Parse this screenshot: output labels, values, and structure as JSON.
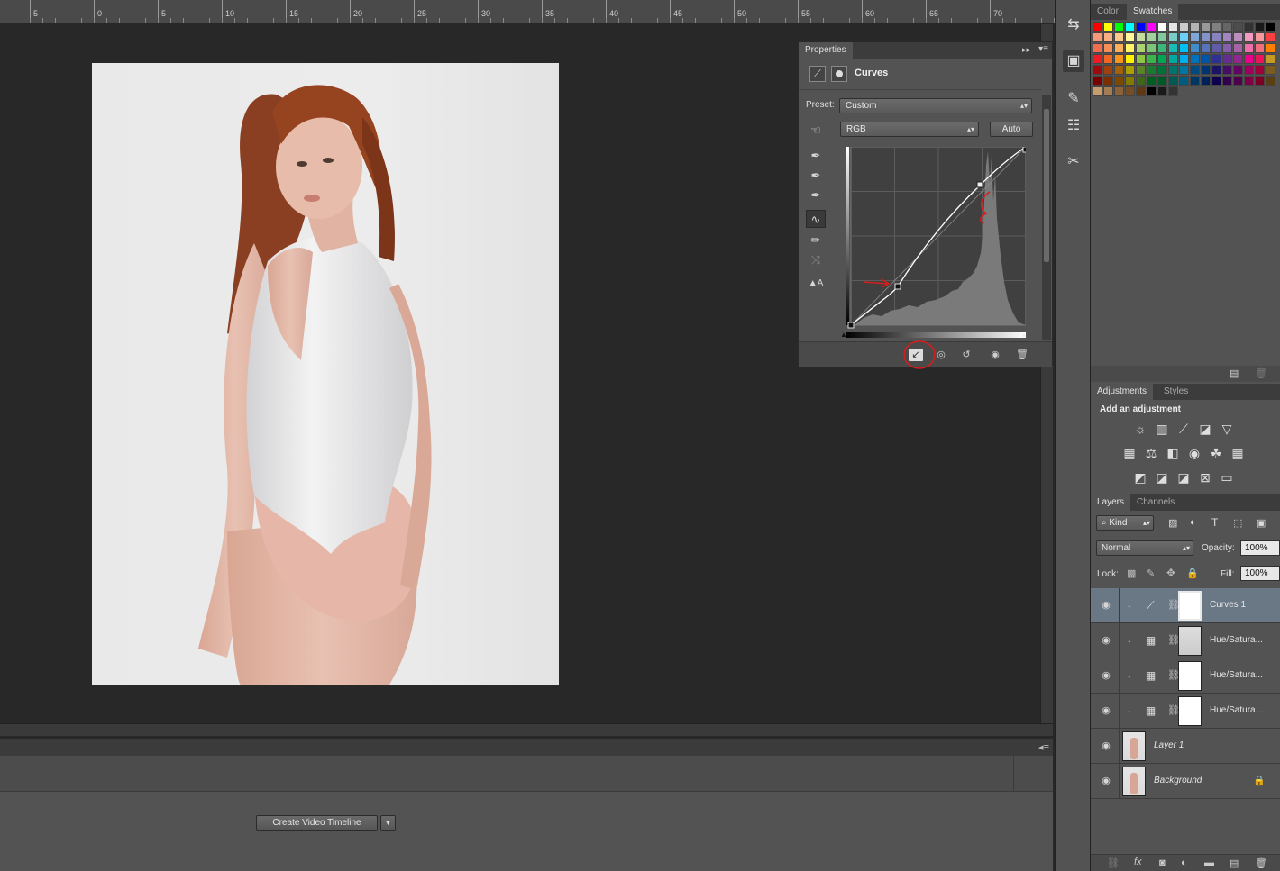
{
  "ruler": {
    "labels": [
      "5",
      "0",
      "5",
      "10",
      "15",
      "20",
      "25",
      "30",
      "35",
      "40",
      "45",
      "50",
      "55",
      "60",
      "65",
      "70"
    ]
  },
  "properties": {
    "tab": "Properties",
    "title": "Curves",
    "preset_label": "Preset:",
    "preset_value": "Custom",
    "channel_value": "RGB",
    "auto_label": "Auto"
  },
  "color_panel": {
    "tabs": [
      "Color",
      "Swatches"
    ],
    "active": "Swatches"
  },
  "adjustments": {
    "tabs": [
      "Adjustments",
      "Styles"
    ],
    "active": "Adjustments",
    "heading": "Add an adjustment"
  },
  "layers_panel": {
    "tabs": [
      "Layers",
      "Channels"
    ],
    "active": "Layers",
    "kind_value": "Kind",
    "blend_mode": "Normal",
    "opacity_label": "Opacity:",
    "opacity_value": "100%",
    "lock_label": "Lock:",
    "fill_label": "Fill:",
    "fill_value": "100%",
    "layers": [
      {
        "name": "Curves 1",
        "type": "adjustment",
        "selected": true
      },
      {
        "name": "Hue/Satura...",
        "type": "adjustment",
        "selected": false
      },
      {
        "name": "Hue/Satura...",
        "type": "adjustment",
        "selected": false
      },
      {
        "name": "Hue/Satura...",
        "type": "adjustment",
        "selected": false
      },
      {
        "name": "Layer 1",
        "type": "pixel",
        "selected": false
      },
      {
        "name": "Background",
        "type": "pixel",
        "selected": false,
        "locked": true
      }
    ]
  },
  "timeline": {
    "create_button": "Create Video Timeline"
  },
  "colors": {
    "panel_bg": "#535353",
    "workspace_bg": "#282828",
    "selected_layer": "#6a7785",
    "annotation_red": "#d81c1c"
  }
}
